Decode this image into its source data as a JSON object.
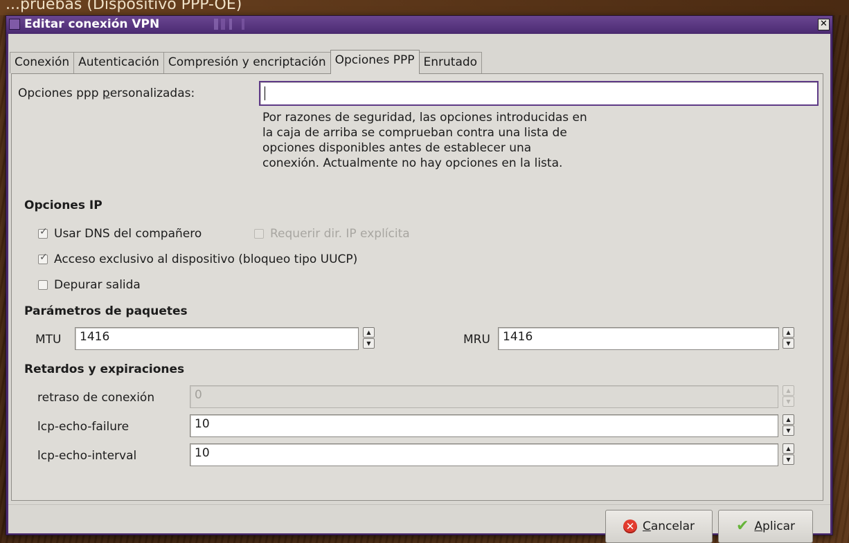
{
  "window": {
    "title": "Editar conexión VPN",
    "close_glyph": "✕"
  },
  "tabs": [
    {
      "label": "Conexión"
    },
    {
      "label": "Autenticación"
    },
    {
      "label": "Compresión y encriptación"
    },
    {
      "label": "Opciones PPP",
      "active": true
    },
    {
      "label": "Enrutado"
    }
  ],
  "ppp": {
    "custom_label_pre": "Opciones ppp ",
    "custom_label_ul": "p",
    "custom_label_post": "ersonalizadas:",
    "custom_value": "",
    "help_lines": [
      "Por razones de seguridad, las opciones introducidas en",
      "la caja de arriba se comprueban contra una lista de",
      "opciones disponibles antes de establecer una",
      "conexión. Actualmente no hay opciones en la lista."
    ]
  },
  "ip_options": {
    "heading": "Opciones IP",
    "use_peer_dns": {
      "label": "Usar DNS del compañero",
      "checked": true
    },
    "require_explicit_ip": {
      "label": "Requerir dir. IP explícita",
      "checked": false,
      "enabled": false
    },
    "exclusive_access": {
      "label": "Acceso exclusivo al dispositivo (bloqueo tipo UUCP)",
      "checked": true
    },
    "debug_output": {
      "label": "Depurar salida",
      "checked": false
    }
  },
  "packet": {
    "heading": "Parámetros de paquetes",
    "mtu_label": "MTU",
    "mtu_value": "1416",
    "mru_label": "MRU",
    "mru_value": "1416"
  },
  "delays": {
    "heading": "Retardos y expiraciones",
    "connect_delay_label": "retraso de conexión",
    "connect_delay_value": "0",
    "lcp_failure_label": "lcp-echo-failure",
    "lcp_failure_value": "10",
    "lcp_interval_label": "lcp-echo-interval",
    "lcp_interval_value": "10"
  },
  "buttons": {
    "cancel_ul": "C",
    "cancel_rest": "ancelar",
    "apply_ul": "A",
    "apply_rest": "plicar"
  },
  "background_text": "...pruebas (Dispositivo PPP-OE)"
}
